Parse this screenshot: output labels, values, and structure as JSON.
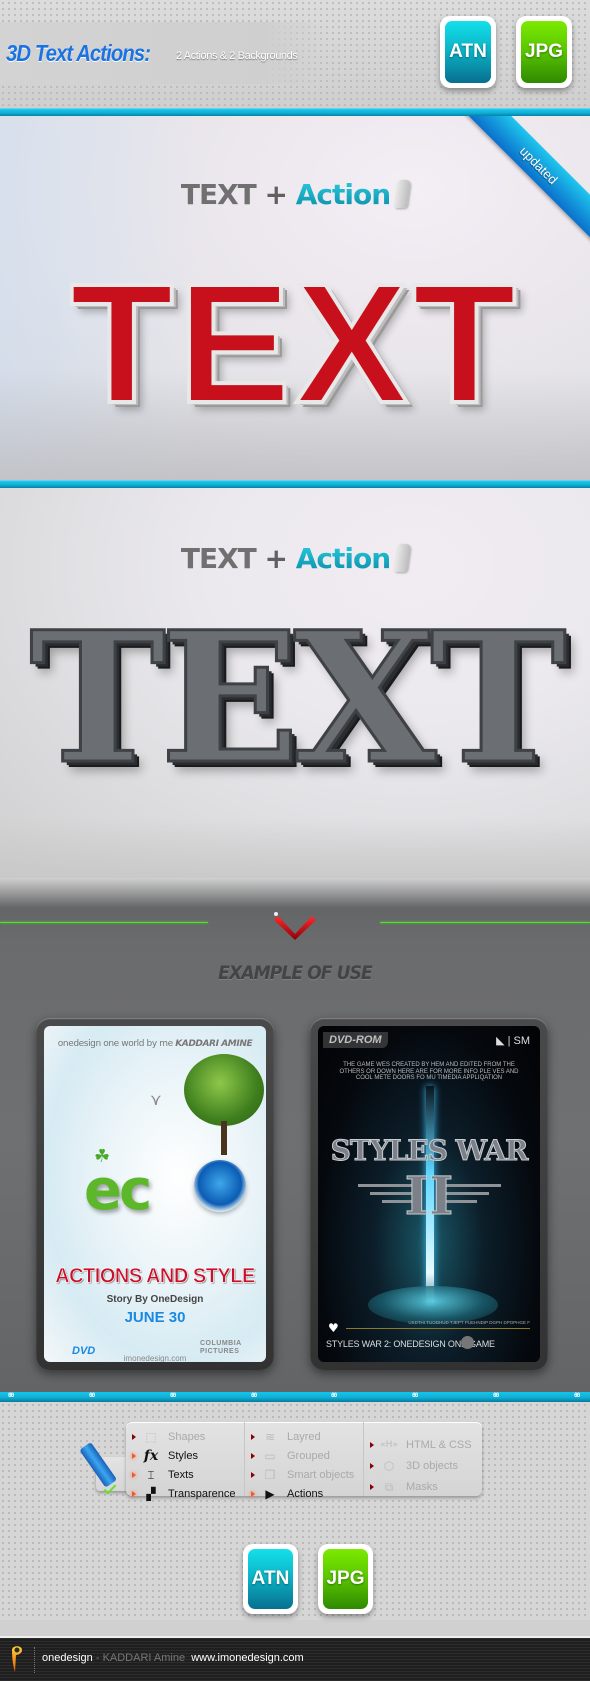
{
  "header": {
    "title": "3D Text Actions:",
    "subtitle": "2 Actions & 2 Backgrounds",
    "badges": [
      {
        "label": "ATN",
        "color": "#0cb5c8"
      },
      {
        "label": "JPG",
        "color": "#5cc800"
      }
    ]
  },
  "preview1": {
    "tagline_text": "TEXT",
    "tagline_plus": "+",
    "tagline_action": "Action",
    "big_text": "TEXT",
    "ribbon": "updated",
    "big_text_color": "#c8101c"
  },
  "preview2": {
    "tagline_text": "TEXT",
    "tagline_plus": "+",
    "tagline_action": "Action",
    "big_text": "TEXT",
    "big_text_color": "#6b6f74"
  },
  "examples": {
    "heading": "EXAMPLE OF USE",
    "eco_cover": {
      "top_line": "onedesign one world by me",
      "top_author": "KADDARI AMINE",
      "word": "ec",
      "title": "ACTIONS AND STYLE",
      "story": "Story By OneDesign",
      "date": "JUNE 30",
      "format": "DVD",
      "url": "imonedesign.com",
      "studio": "COLUMBIA PICTURES"
    },
    "game_cover": {
      "badge": "DVD-ROM",
      "logo": "SM",
      "blurb": "THE GAME WES CREATED BY HEM AND EDITED FROM THE OTHERS OR DOWN HERE ARE FOR MORE INFO PLE VES AND COOL METE DOORS FO MU TIMEDIA APPLIQATION",
      "title": "STYLES WAR",
      "numeral": "II",
      "footer": "STYLES WAR 2: ONEDESIGN ONE GAME",
      "small_print": "USDTHI TUODHUD TJEPT PUEHNDIP DGPH DPOPHGE F"
    }
  },
  "features": {
    "columns": [
      [
        {
          "label": "Shapes",
          "icon": "shapes-icon",
          "glyph": "⬚",
          "active": false
        },
        {
          "label": "Styles",
          "icon": "fx-icon",
          "glyph": "fx",
          "active": true
        },
        {
          "label": "Texts",
          "icon": "text-box-icon",
          "glyph": "⌶",
          "active": true
        },
        {
          "label": "Transparence",
          "icon": "transparency-icon",
          "glyph": "▞",
          "active": true
        }
      ],
      [
        {
          "label": "Layred",
          "icon": "layers-icon",
          "glyph": "≋",
          "active": false
        },
        {
          "label": "Grouped",
          "icon": "folder-icon",
          "glyph": "▭",
          "active": false
        },
        {
          "label": "Smart objects",
          "icon": "smart-object-icon",
          "glyph": "❐",
          "active": false
        },
        {
          "label": "Actions",
          "icon": "actions-scroll-icon",
          "glyph": "▶",
          "active": true
        }
      ],
      [
        {
          "label": "HTML & CSS",
          "icon": "html-icon",
          "glyph": "«H»",
          "active": false
        },
        {
          "label": "3D objects",
          "icon": "cube-icon",
          "glyph": "⬡",
          "active": false
        },
        {
          "label": "Masks",
          "icon": "masks-icon",
          "glyph": "⧉",
          "active": false
        }
      ]
    ],
    "badges": [
      {
        "label": "ATN"
      },
      {
        "label": "JPG"
      }
    ]
  },
  "footer": {
    "brand": "onedesign",
    "dash": " - ",
    "author": "KADDARI Amine",
    "url": "www.imonedesign.com"
  },
  "colors": {
    "accent_blue": "#16c3ea",
    "title_blue": "#1a73e0",
    "green_line": "#4ee02a",
    "chevron_red": "#d0101a"
  }
}
